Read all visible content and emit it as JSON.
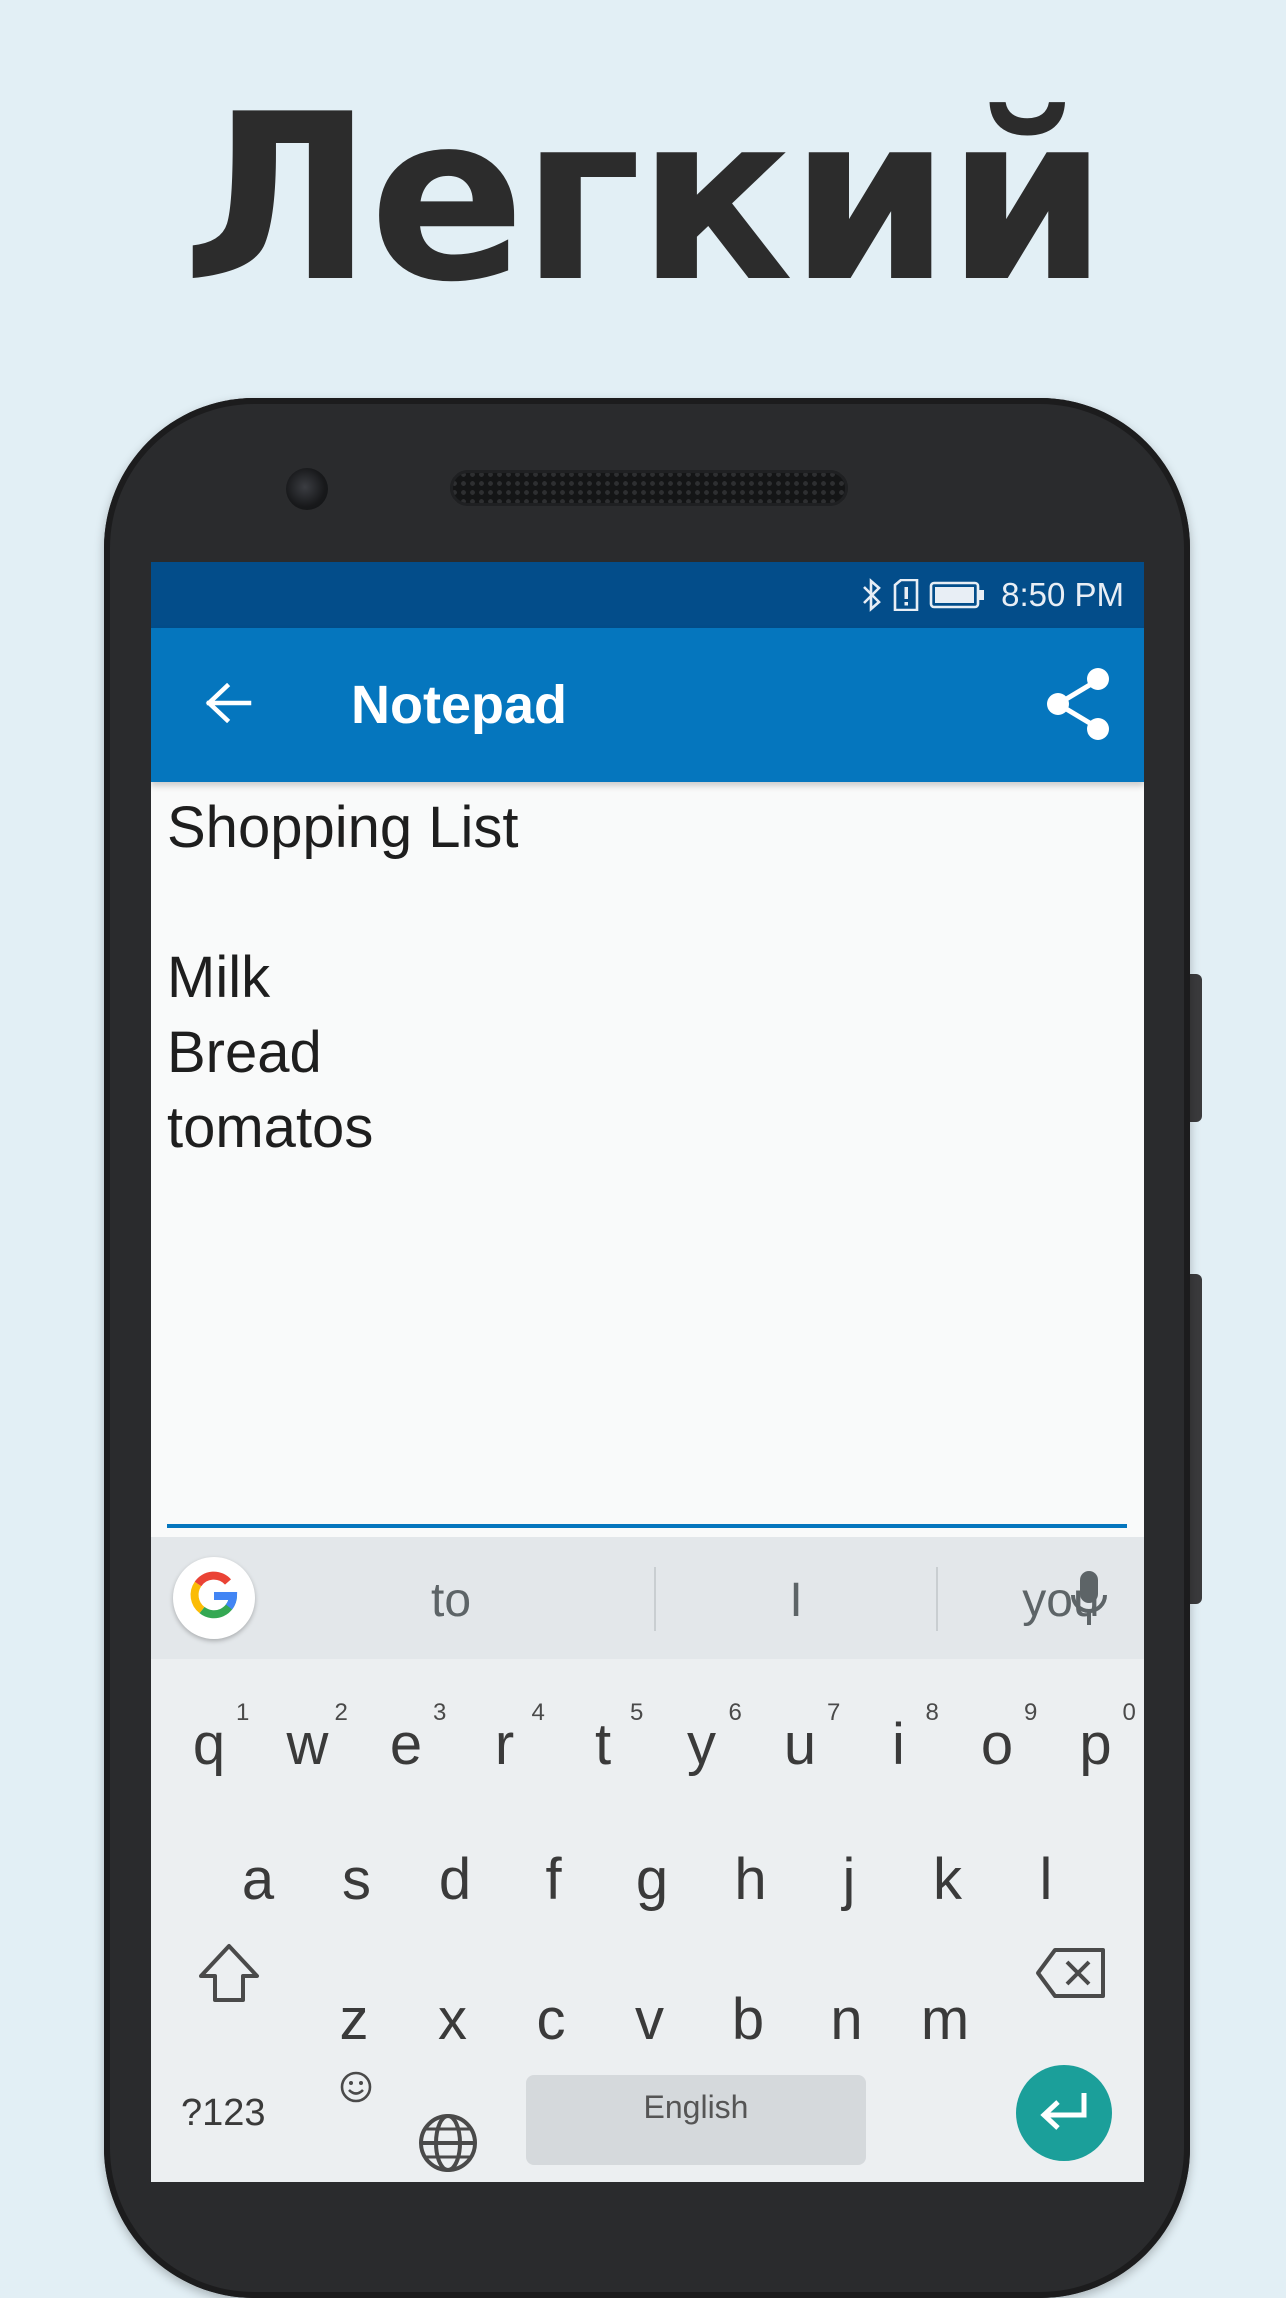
{
  "headline": "Легкий",
  "status_bar": {
    "time": "8:50 PM",
    "icons": [
      "bluetooth-icon",
      "sim-alert-icon",
      "battery-icon"
    ]
  },
  "app_bar": {
    "title": "Notepad",
    "back_icon": "arrow-left-icon",
    "share_icon": "share-icon"
  },
  "note": {
    "lines": [
      "Shopping List",
      "",
      "Milk",
      "Bread",
      "tomatos"
    ]
  },
  "keyboard": {
    "suggestions": [
      "to",
      "I",
      "you"
    ],
    "row1": [
      "q",
      "w",
      "e",
      "r",
      "t",
      "y",
      "u",
      "i",
      "o",
      "p"
    ],
    "row1_hints": [
      "1",
      "2",
      "3",
      "4",
      "5",
      "6",
      "7",
      "8",
      "9",
      "0"
    ],
    "row2": [
      "a",
      "s",
      "d",
      "f",
      "g",
      "h",
      "j",
      "k",
      "l"
    ],
    "row3": [
      "z",
      "x",
      "c",
      "v",
      "b",
      "n",
      "m"
    ],
    "symbols_label": "?123",
    "space_label": "English",
    "colors": {
      "enter": "#1b9f9a",
      "app_bar": "#0576be",
      "status_bar": "#034d8a"
    }
  }
}
